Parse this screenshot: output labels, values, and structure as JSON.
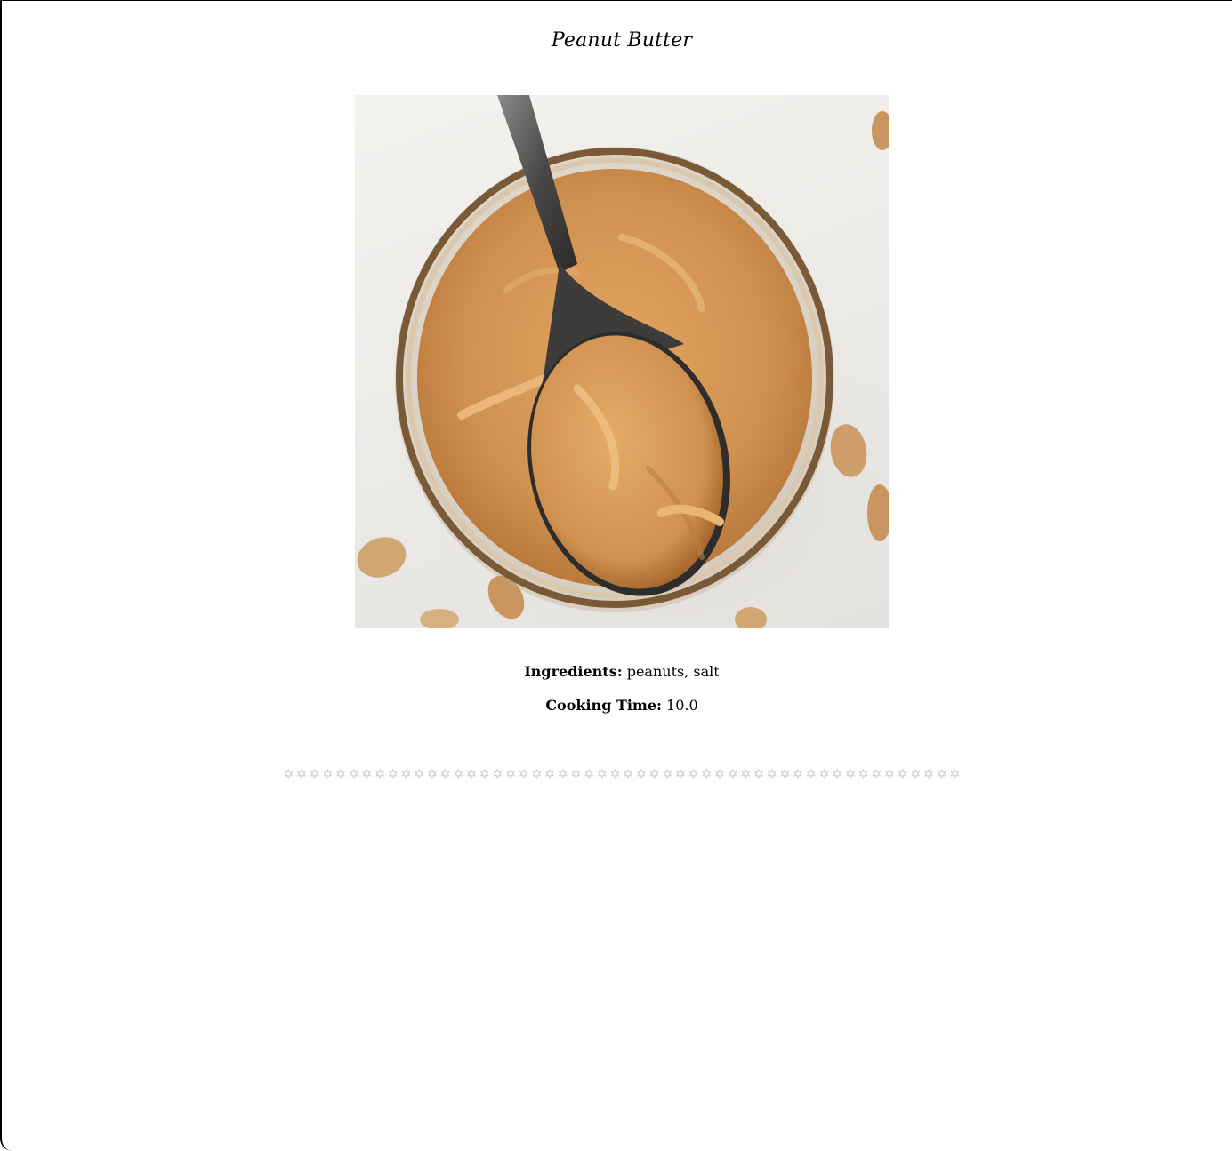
{
  "recipe": {
    "title": "Peanut Butter",
    "ingredients_label": "Ingredients:",
    "ingredients_value": "peanuts, salt",
    "cooking_time_label": "Cooking Time:",
    "cooking_time_value": "10.0"
  },
  "rating": {
    "value": 0,
    "max": 52,
    "star_glyph": "✡",
    "star_color": "#c9c9c9"
  },
  "colors": {
    "background": "#ffffff",
    "text": "#000000",
    "peanut_butter": "#c98a45"
  },
  "icons": {
    "rating_star": "star-outline-icon"
  }
}
